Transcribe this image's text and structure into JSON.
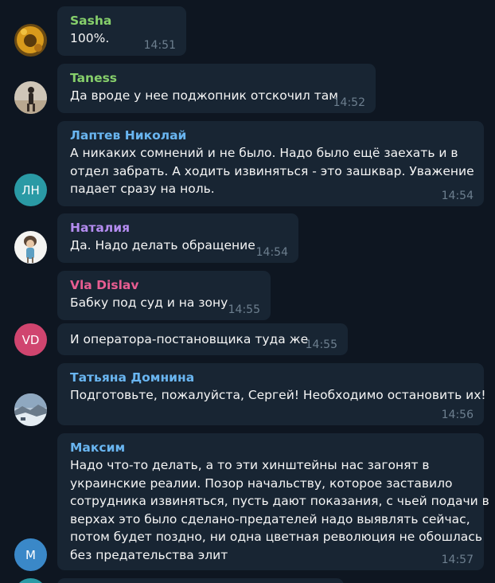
{
  "colors": {
    "background": "#0e1621",
    "bubble": "#182533",
    "message_text": "#f5f5f5",
    "timestamp": "#6d7f8f"
  },
  "messages": [
    {
      "sender": "Sasha",
      "sender_color": "#86cf6b",
      "lines": [
        "100%."
      ],
      "time": "14:51"
    },
    {
      "sender": "Taness",
      "sender_color": "#86cf6b",
      "lines": [
        "Да вроде у нее поджопник отскочил там"
      ],
      "time": "14:52"
    },
    {
      "sender": "Лаптев Николай",
      "sender_color": "#69b5f0",
      "lines": [
        "А никаких сомнений и не было. Надо было ещё заехать и в",
        "отдел забрать. А ходить извиняться - это зашквар. Уважение",
        "падает сразу на ноль."
      ],
      "time": "14:54"
    },
    {
      "sender": "Наталия",
      "sender_color": "#b48cf0",
      "lines": [
        "Да. Надо делать обращение"
      ],
      "time": "14:54"
    },
    {
      "sender": "Vla Dislav",
      "sender_color": "#e85d91",
      "lines": [
        "Бабку под суд и на зону"
      ],
      "time": "14:55"
    },
    {
      "sender": "",
      "sender_color": "",
      "lines": [
        "И оператора-постановщика туда же"
      ],
      "time": "14:55"
    },
    {
      "sender": "Татьяна Домнина",
      "sender_color": "#69b5f0",
      "lines": [
        "Подготовьте, пожалуйста, Сергей! Необходимо остановить их!"
      ],
      "time": "14:56"
    },
    {
      "sender": "Максим",
      "sender_color": "#69b5f0",
      "lines": [
        "Надо что-то делать, а то эти хинштейны нас загонят в",
        "украинские реалии. Позор начальству, которое заставило",
        "сотрудника извиняться, пусть дают показания, с чьей подачи в",
        "верхах это было сделано-предателей надо выявлять сейчас,",
        "потом будет поздно, ни одна цветная революция не обошлась",
        "без предательства элит"
      ],
      "time": "14:57"
    }
  ],
  "avatars": [
    {
      "kind": "photo",
      "icon": "sunflower-photo-avatar"
    },
    {
      "kind": "photo",
      "icon": "beach-person-photo-avatar"
    },
    {
      "kind": "initials",
      "initials": "ЛН",
      "color": "#2a9aa5"
    },
    {
      "kind": "photo",
      "icon": "cartoon-woman-photo-avatar"
    },
    {
      "kind": "initials",
      "initials": "VD",
      "color": "#d0456f"
    },
    {
      "kind": "photo",
      "icon": "winter-landscape-photo-avatar"
    },
    {
      "kind": "initials",
      "initials": "М",
      "color": "#3a88c8"
    }
  ]
}
